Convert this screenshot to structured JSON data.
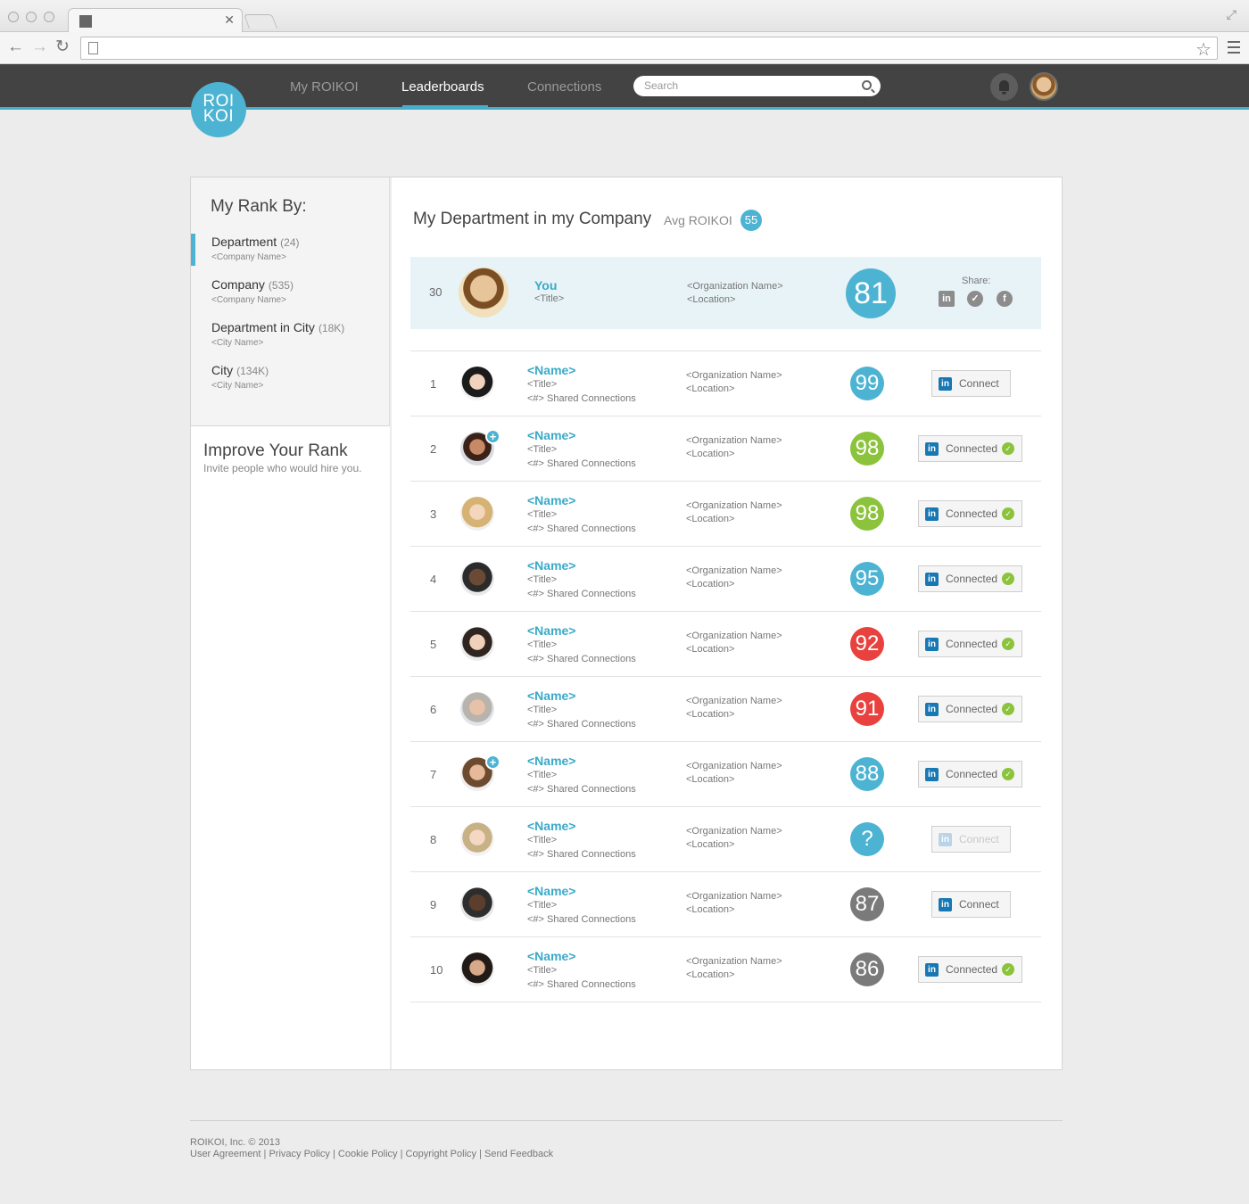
{
  "app": {
    "logo_top": "ROI",
    "logo_bottom": "KOI",
    "nav": [
      "My ROIKOI",
      "Leaderboards",
      "Connections"
    ],
    "search_placeholder": "Search"
  },
  "colors": {
    "accent": "#4db3d2",
    "green": "#8cc33c",
    "red": "#e8413e",
    "gray": "#7a7a7a",
    "linkedin": "#1878b3"
  },
  "sidebar": {
    "title": "My Rank By:",
    "items": [
      {
        "label": "Department",
        "count": "(24)",
        "sub": "<Company Name>",
        "active": true
      },
      {
        "label": "Company",
        "count": "(535)",
        "sub": "<Company Name>",
        "active": false
      },
      {
        "label": "Department in City",
        "count": "(18K)",
        "sub": "<City Name>",
        "active": false
      },
      {
        "label": "City",
        "count": "(134K)",
        "sub": "<City Name>",
        "active": false
      }
    ],
    "improve_title": "Improve Your Rank",
    "improve_sub": "Invite people who would hire you."
  },
  "main": {
    "title": "My Department in my Company",
    "avg_label": "Avg ROIKOI",
    "avg_value": "55",
    "you": {
      "rank": "30",
      "name": "You",
      "title": "<Title>",
      "org": "<Organization Name>",
      "location": "<Location>",
      "score": "81",
      "share_label": "Share:",
      "share_icons": [
        "linkedin-icon",
        "twitter-icon",
        "facebook-icon"
      ]
    },
    "rows": [
      {
        "rank": "1",
        "name": "<Name>",
        "title": "<Title>",
        "shared": "<#> Shared Connections",
        "org": "<Organization  Name>",
        "location": "<Location>",
        "score": "99",
        "score_color": "blue",
        "action": "Connect",
        "state": "connect",
        "plus": false
      },
      {
        "rank": "2",
        "name": "<Name>",
        "title": "<Title>",
        "shared": "<#> Shared Connections",
        "org": "<Organization  Name>",
        "location": "<Location>",
        "score": "98",
        "score_color": "green",
        "action": "Connected",
        "state": "connected",
        "plus": true
      },
      {
        "rank": "3",
        "name": "<Name>",
        "title": "<Title>",
        "shared": "<#> Shared Connections",
        "org": "<Organization  Name>",
        "location": "<Location>",
        "score": "98",
        "score_color": "green",
        "action": "Connected",
        "state": "connected",
        "plus": false
      },
      {
        "rank": "4",
        "name": "<Name>",
        "title": "<Title>",
        "shared": "<#> Shared Connections",
        "org": "<Organization  Name>",
        "location": "<Location>",
        "score": "95",
        "score_color": "blue",
        "action": "Connected",
        "state": "connected",
        "plus": false
      },
      {
        "rank": "5",
        "name": "<Name>",
        "title": "<Title>",
        "shared": "<#> Shared Connections",
        "org": "<Organization  Name>",
        "location": "<Location>",
        "score": "92",
        "score_color": "red",
        "action": "Connected",
        "state": "connected",
        "plus": false
      },
      {
        "rank": "6",
        "name": "<Name>",
        "title": "<Title>",
        "shared": "<#> Shared Connections",
        "org": "<Organization  Name>",
        "location": "<Location>",
        "score": "91",
        "score_color": "red",
        "action": "Connected",
        "state": "connected",
        "plus": false
      },
      {
        "rank": "7",
        "name": "<Name>",
        "title": "<Title>",
        "shared": "<#> Shared Connections",
        "org": "<Organization  Name>",
        "location": "<Location>",
        "score": "88",
        "score_color": "blue",
        "action": "Connected",
        "state": "connected",
        "plus": true
      },
      {
        "rank": "8",
        "name": "<Name>",
        "title": "<Title>",
        "shared": "<#> Shared Connections",
        "org": "<Organization  Name>",
        "location": "<Location>",
        "score": "?",
        "score_color": "blue",
        "action": "Connect",
        "state": "disabled",
        "plus": false
      },
      {
        "rank": "9",
        "name": "<Name>",
        "title": "<Title>",
        "shared": "<#> Shared Connections",
        "org": "<Organization  Name>",
        "location": "<Location>",
        "score": "87",
        "score_color": "gray",
        "action": "Connect",
        "state": "connect",
        "plus": false
      },
      {
        "rank": "10",
        "name": "<Name>",
        "title": "<Title>",
        "shared": "<#> Shared Connections",
        "org": "<Organization  Name>",
        "location": "<Location>",
        "score": "86",
        "score_color": "gray",
        "action": "Connected",
        "state": "connected",
        "plus": false
      }
    ]
  },
  "footer": {
    "copyright": "ROIKOI, Inc. © 2013",
    "links": [
      "User Agreement",
      "Privacy Policy",
      "Cookie Policy",
      "Copyright Policy",
      "Send Feedback"
    ]
  }
}
